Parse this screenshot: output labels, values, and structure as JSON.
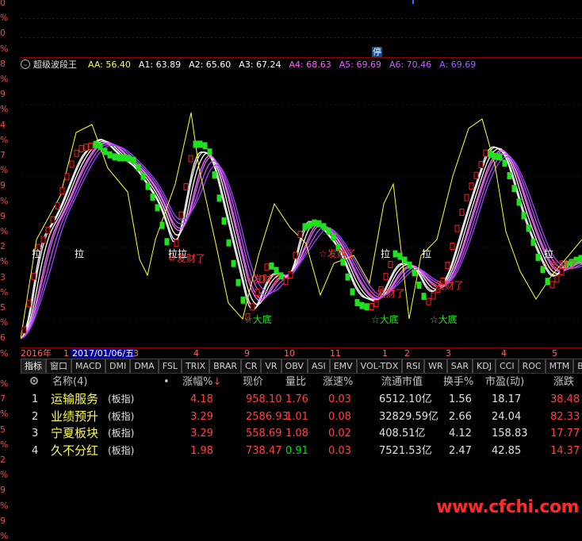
{
  "left_axis_labels": [
    "0",
    "%",
    "0",
    "%",
    "8",
    "%",
    "9",
    "%",
    "4",
    "%",
    "7",
    "%",
    "9",
    "%",
    "9",
    "%",
    "2",
    "%",
    "3",
    "%",
    "5",
    "%",
    "6",
    "%",
    "",
    "%",
    "7",
    "%",
    "5",
    "%",
    "2",
    "%",
    "9",
    "%",
    "9",
    "%"
  ],
  "top_marker_label": "停",
  "indicator": {
    "name": "超级波段王",
    "values": [
      {
        "label": "AA: 56.40",
        "color": "#ffff40"
      },
      {
        "label": "A1: 63.89",
        "color": "#ffffff"
      },
      {
        "label": "A2: 65.60",
        "color": "#ffffff"
      },
      {
        "label": "A3: 67.24",
        "color": "#ffffff"
      },
      {
        "label": "A4: 68.63",
        "color": "#ff60ff"
      },
      {
        "label": "A5: 69.69",
        "color": "#e060ff"
      },
      {
        "label": "A6: 70.46",
        "color": "#c060ff"
      },
      {
        "label": "A: 69.69",
        "color": "#a060ff"
      }
    ]
  },
  "annotations": {
    "la": "拉",
    "la_la": "拉拉",
    "fa_cai": "☆发财了",
    "da_di": "☆大底"
  },
  "date_bar": {
    "items": [
      "2016年",
      "1",
      "2017/01/06/五",
      "3",
      "4",
      "9",
      "10",
      "11",
      "1",
      "2",
      "3",
      "4",
      "5"
    ]
  },
  "tabs": [
    "指标",
    "窗口",
    "MACD",
    "DMI",
    "DMA",
    "FSL",
    "TRIX",
    "BRAR",
    "CR",
    "VR",
    "OBV",
    "ASI",
    "EMV",
    "VOL-TDX",
    "RSI",
    "WR",
    "SAR",
    "KDJ",
    "CCI",
    "ROC",
    "MTM",
    "BOLL"
  ],
  "table": {
    "headers": {
      "name": "名称(4)",
      "dot": "•",
      "change": "涨幅%",
      "price": "现价",
      "vol_ratio": "量比",
      "speed": "涨速%",
      "mcap": "流通市值",
      "turnover": "换手%",
      "pe": "市盈(动)",
      "delta": "涨跌"
    },
    "rows": [
      {
        "idx": "1",
        "name": "运输服务",
        "type": "(板指)",
        "change": "4.18",
        "price": "958.10",
        "vol_ratio": "1.76",
        "speed": "0.03",
        "mcap": "6512.10亿",
        "turnover": "1.56",
        "pe": "18.17",
        "delta": "38.48",
        "vol_color": "red"
      },
      {
        "idx": "2",
        "name": "业绩预升",
        "type": "(板指)",
        "change": "3.29",
        "price": "2586.93",
        "vol_ratio": "1.01",
        "speed": "0.08",
        "mcap": "32829.59亿",
        "turnover": "2.66",
        "pe": "24.04",
        "delta": "82.33",
        "vol_color": "red"
      },
      {
        "idx": "3",
        "name": "宁夏板块",
        "type": "(板指)",
        "change": "3.29",
        "price": "558.69",
        "vol_ratio": "1.08",
        "speed": "0.02",
        "mcap": "408.51亿",
        "turnover": "4.12",
        "pe": "158.83",
        "delta": "17.77",
        "vol_color": "red"
      },
      {
        "idx": "4",
        "name": "久不分红",
        "type": "(板指)",
        "change": "1.98",
        "price": "738.47",
        "vol_ratio": "0.91",
        "speed": "0.03",
        "mcap": "7521.53亿",
        "turnover": "2.47",
        "pe": "42.85",
        "delta": "14.37",
        "vol_color": "green"
      }
    ]
  },
  "watermark": "www.cfchi.com",
  "colors": {
    "up": "#ff3030",
    "down": "#20e020",
    "aa_line": "#ffff30",
    "bg": "#000000",
    "accent_blue": "#0050a0"
  }
}
